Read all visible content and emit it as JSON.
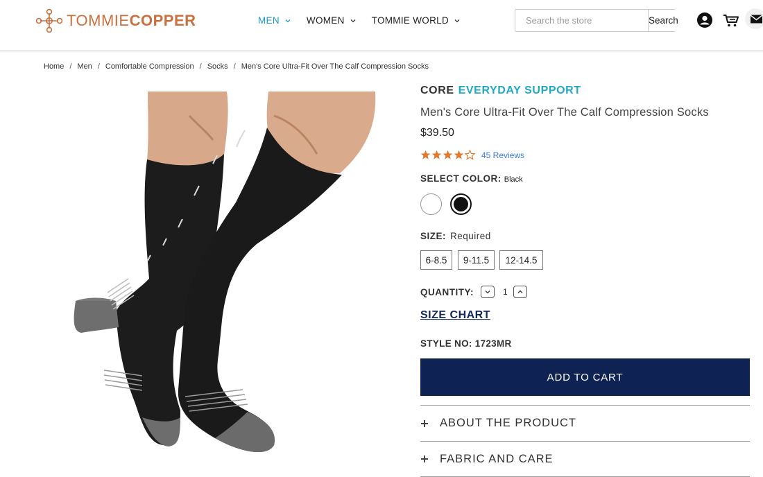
{
  "brand": {
    "name_light": "TOMMIE",
    "name_bold": "COPPER",
    "color": "#c8703f"
  },
  "nav": [
    {
      "label": "MEN",
      "active": true
    },
    {
      "label": "WOMEN",
      "active": false
    },
    {
      "label": "TOMMIE WORLD",
      "active": false
    }
  ],
  "search": {
    "placeholder": "Search the store",
    "button": "Search"
  },
  "header_icons": [
    "account-icon",
    "cart-icon",
    "mail-icon"
  ],
  "breadcrumb": [
    "Home",
    "Men",
    "Comfortable Compression",
    "Socks",
    "Men's Core Ultra-Fit Over The Calf Compression Socks"
  ],
  "product": {
    "line_prefix": "CORE",
    "line_accent": "EVERYDAY SUPPORT",
    "title": "Men's Core Ultra-Fit Over The Calf Compression Socks",
    "price": "$39.50",
    "rating": 4,
    "rating_max": 5,
    "reviews": "45 Reviews",
    "color_label": "SELECT COLOR:",
    "color_value": "Black",
    "colors": [
      "White",
      "Black"
    ],
    "size_label": "SIZE:",
    "size_required": "Required",
    "sizes": [
      "6-8.5",
      "9-11.5",
      "12-14.5"
    ],
    "quantity_label": "QUANTITY:",
    "quantity": "1",
    "size_chart": "SIZE CHART",
    "style_no": "STYLE NO: 1723MR",
    "add_to_cart": "ADD TO CART",
    "accordions": [
      "ABOUT THE PRODUCT",
      "FABRIC AND CARE"
    ]
  },
  "colors": {
    "accent": "#1fa9c6",
    "nav_active": "#1e9bc4",
    "button_bg": "#0e2353",
    "star": "#e07a2e",
    "link": "#3a7bd5"
  }
}
